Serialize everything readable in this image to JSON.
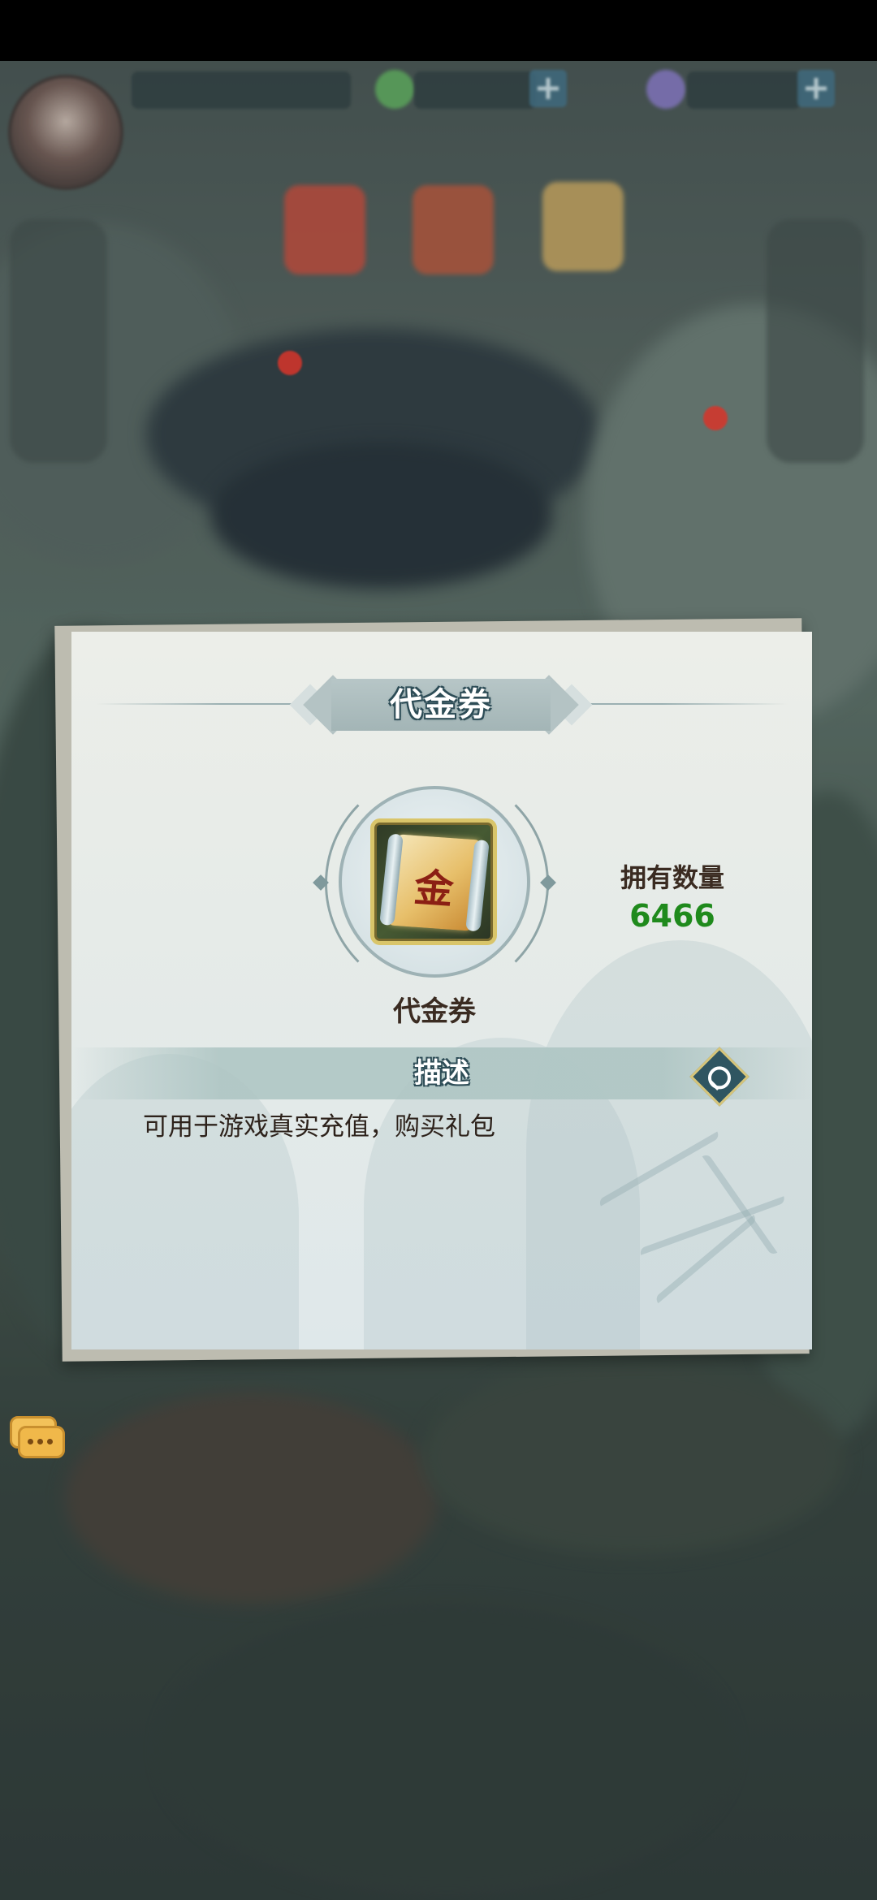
{
  "modal": {
    "title": "代金券",
    "item_name": "代金券",
    "item_glyph": "金",
    "owned_label": "拥有数量",
    "owned_count": "6466",
    "description_title": "描述",
    "description": "可用于游戏真实充值，购买礼包"
  },
  "icons": {
    "search": "search-icon",
    "chat": "chat-icon",
    "coupon": "gold-coupon-icon"
  },
  "colors": {
    "owned_count": "#1f8a1c",
    "banner": "#a3b5b6",
    "text": "#3a2b21"
  }
}
